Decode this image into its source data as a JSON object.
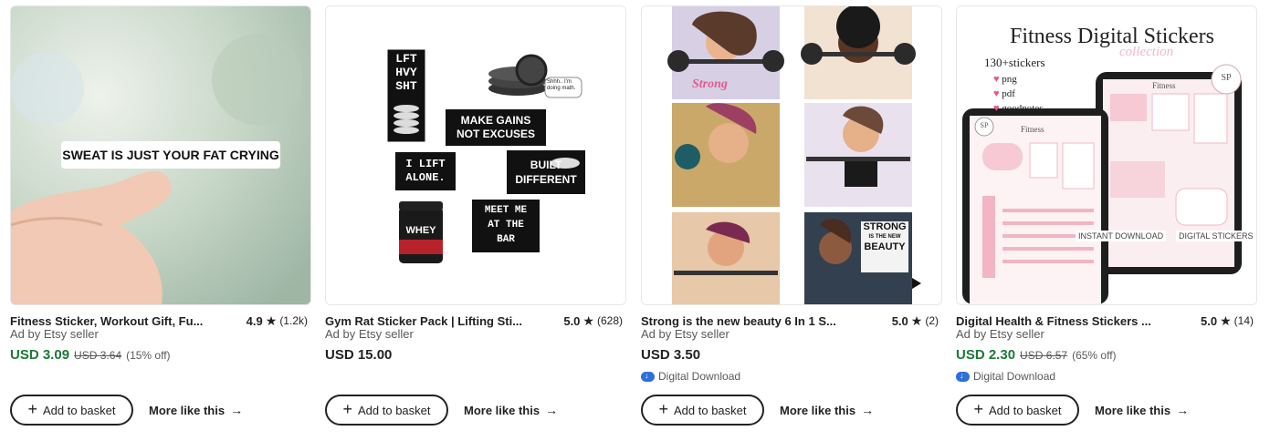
{
  "products": [
    {
      "title": "Fitness Sticker, Workout Gift, Fu...",
      "rating": "4.9",
      "reviews": "(1.2k)",
      "ad_text": "Ad by Etsy seller",
      "price": "USD 3.09",
      "original_price": "USD 3.64",
      "discount": "(15% off)",
      "image_text": "SWEAT IS JUST YOUR FAT CRYING",
      "basket_label": "Add to basket",
      "more_label": "More like this"
    },
    {
      "title": "Gym Rat Sticker Pack | Lifting Sti...",
      "rating": "5.0",
      "reviews": "(628)",
      "ad_text": "Ad by Etsy seller",
      "price": "USD 15.00",
      "image_texts": [
        "LFT",
        "HVY",
        "SHT",
        "MAKE GAINS",
        "NOT EXCUSES",
        "I LIFT",
        "ALONE.",
        "BUILT",
        "DIFFERENT",
        "MEET ME",
        "AT THE",
        "BAR",
        "WHEY",
        "Shhh.. I'm doing math."
      ],
      "basket_label": "Add to basket",
      "more_label": "More like this"
    },
    {
      "title": "Strong is the new beauty 6 In 1 S...",
      "rating": "5.0",
      "reviews": "(2)",
      "ad_text": "Ad by Etsy seller",
      "price": "USD 3.50",
      "download": "Digital Download",
      "image_texts": [
        "Strong",
        "STRONG",
        "IS THE NEW",
        "BEAUTY"
      ],
      "basket_label": "Add to basket",
      "more_label": "More like this"
    },
    {
      "title": "Digital Health & Fitness Stickers ...",
      "rating": "5.0",
      "reviews": "(14)",
      "ad_text": "Ad by Etsy seller",
      "price": "USD 2.30",
      "original_price": "USD 6.57",
      "discount": "(65% off)",
      "download": "Digital Download",
      "image_texts": [
        "Fitness Digital Stickers",
        "collection",
        "130+stickers",
        "png",
        "pdf",
        "goodnotes",
        "SP",
        "Fitness",
        "INSTANT DOWNLOAD",
        "DIGITAL STICKERS"
      ],
      "basket_label": "Add to basket",
      "more_label": "More like this"
    }
  ],
  "colors": {
    "sale": "#1b7a36",
    "download_icon": "#2f6fdb",
    "text": "#222222",
    "muted": "#595959"
  }
}
